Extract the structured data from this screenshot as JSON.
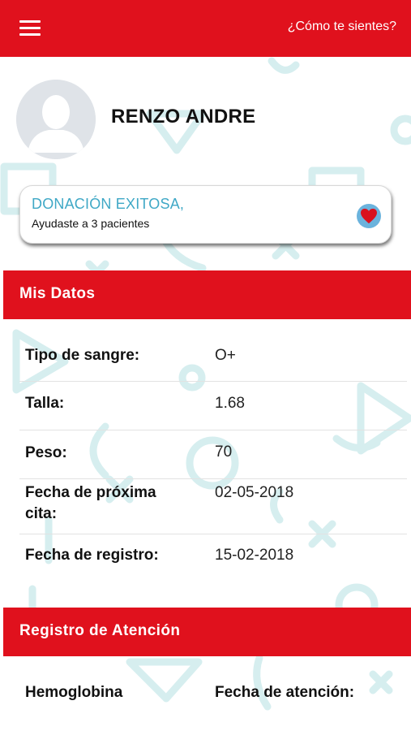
{
  "header": {
    "menu_icon": "hamburger-menu-icon",
    "feeling_link": "¿Cómo te sientes?"
  },
  "profile": {
    "name": "RENZO ANDRE",
    "avatar_icon": "user-avatar-icon"
  },
  "donation": {
    "title": "DONACIÓN EXITOSA,",
    "subtitle": "Ayudaste a 3 pacientes",
    "icon": "heart-icon",
    "accent_color": "#3fa8c6"
  },
  "mis_datos": {
    "title": "Mis Datos",
    "rows": [
      {
        "label": "Tipo de sangre:",
        "value": "O+"
      },
      {
        "label": "Talla:",
        "value": "1.68"
      },
      {
        "label": "Peso:",
        "value": "70"
      },
      {
        "label": "Fecha de próxima cita:",
        "value": "02-05-2018"
      },
      {
        "label": "Fecha de registro:",
        "value": "15-02-2018"
      }
    ]
  },
  "registro_atencion": {
    "title": "Registro de Atención",
    "columns": [
      "Hemoglobina",
      "Fecha de atención:"
    ]
  },
  "colors": {
    "brand_red": "#e0111d",
    "background_shapes": "#d6eeef"
  }
}
